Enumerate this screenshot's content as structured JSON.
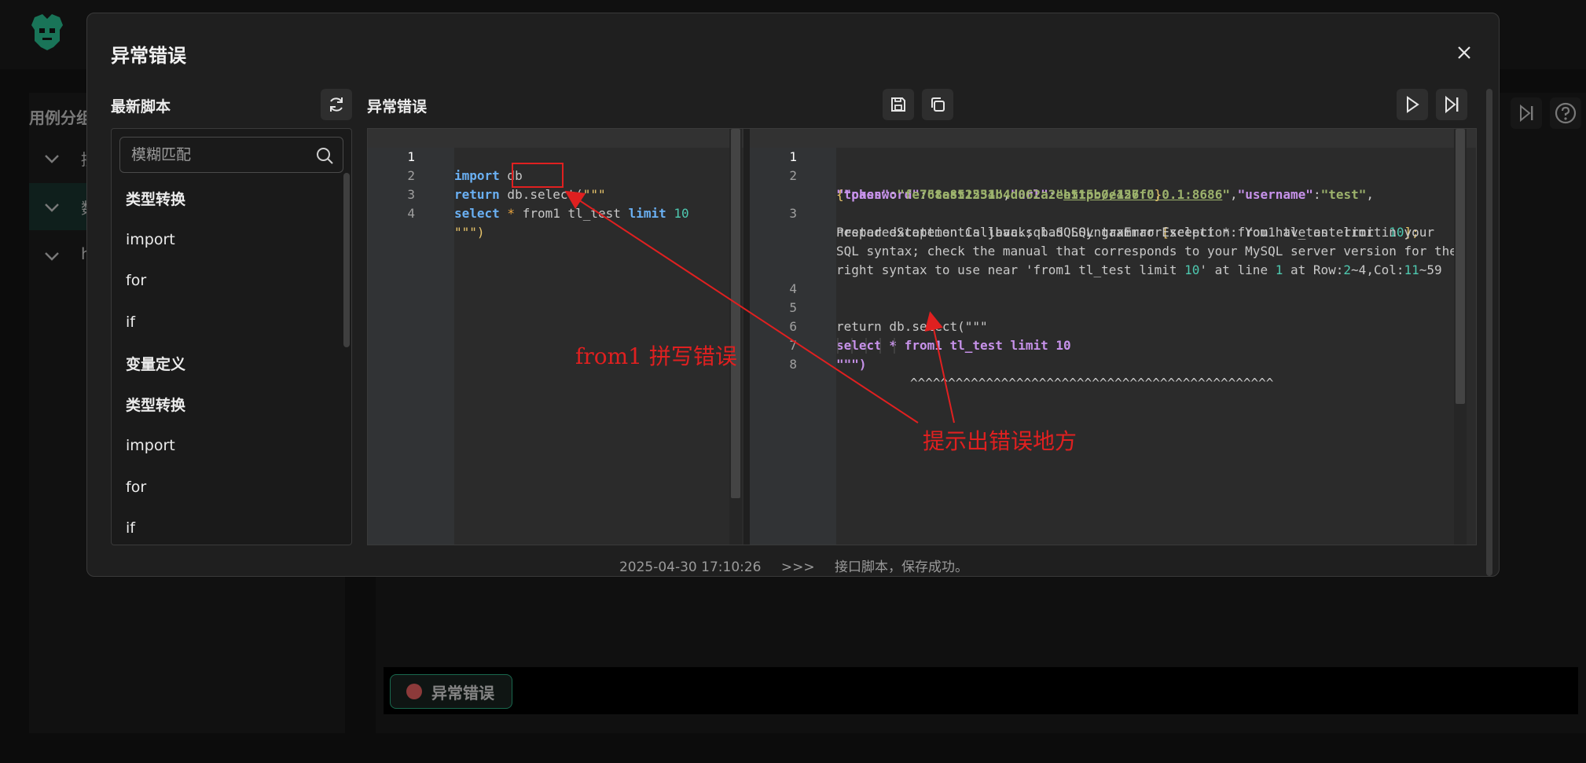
{
  "background": {
    "sidebar_title": "用例分组",
    "tree_items": [
      "接",
      "数",
      "h"
    ],
    "bottom_tag_label": "异常错误"
  },
  "modal": {
    "title": "异常错误",
    "left_panel": {
      "title": "最新脚本",
      "search_placeholder": "模糊匹配",
      "items": [
        {
          "label": "类型转换",
          "bold": true
        },
        {
          "label": "import",
          "bold": false
        },
        {
          "label": "for",
          "bold": false
        },
        {
          "label": "if",
          "bold": false
        },
        {
          "label": "变量定义",
          "bold": true
        },
        {
          "label": "类型转换",
          "bold": true
        },
        {
          "label": "import",
          "bold": false
        },
        {
          "label": "for",
          "bold": false
        },
        {
          "label": "if",
          "bold": false
        }
      ]
    },
    "editor_title": "异常错误",
    "source_code": {
      "line_numbers": [
        "1",
        "2",
        "3",
        "4"
      ],
      "l1_kw": "import",
      "l1_rest": " db",
      "l2_kw": "return",
      "l2_rest": " db.select(",
      "l2_str": "\"\"\"",
      "l3_kw": "select",
      "l3_star": " * ",
      "l3_from": "from1",
      "l3_table": " tl_test ",
      "l3_limit": "limit",
      "l3_num": " 10",
      "l4_str": "\"\"\")"
    },
    "error_output": {
      "line_numbers": [
        "1",
        "2",
        "3",
        "4",
        "5",
        "6",
        "7",
        "8"
      ],
      "json_open": "{",
      "k_password": "\"password\"",
      "v_password": "\"test1234\"",
      "k_url": "\"url\"",
      "v_url_q1": "\"",
      "v_url": "http://127.0.0.1:8686",
      "v_url_q2": "\"",
      "k_username": "\"username\"",
      "v_username": "\"test\"",
      "k_token": "\"token\"",
      "v_token": "\"fe768a852551b4d062a2ee515b0e456f\"",
      "json_close": "}",
      "err_a": "PreparedStatementCallback; bad SQL grammar ",
      "err_b_open": "[",
      "err_c": "select * from1 tl_test limit ",
      "err_c_num": "10",
      "err_d": "];",
      "err_line2": "nested exception is java.sql.SQLSyntaxErrorException: You have an error in your",
      "err_line3": "SQL syntax; check the manual that corresponds to your MySQL server version for the",
      "err_line4a": "right syntax to use near 'from1 tl_test limit ",
      "err_line4b": "10",
      "err_line4c": "' at line ",
      "err_line4d": "1",
      "err_line4e": " at Row:",
      "err_line4f": "2",
      "err_line4g": "~4,Col:",
      "err_line4h": "11",
      "err_line4i": "~59",
      "l5_return": "return db.select(\"\"\"",
      "l6_sql": "select * from1 tl_test limit 10",
      "l7_close": "\"\"\")",
      "l8_caret": "^^^^^^^^^^^^^^^^^^^^^^^^^^^^^^^^^^^^^^^^^^^^^^^^"
    },
    "status": {
      "timestamp": "2025-04-30 17:10:26",
      "separator": ">>>",
      "message": "接口脚本，保存成功。"
    }
  },
  "annotations": {
    "spelling_error": "from1  拼写错误",
    "error_location": "提示出错误地方"
  },
  "colors": {
    "accent": "#2fbf8f",
    "annotation": "#e02020",
    "modal_bg": "#1f1f1f",
    "editor_bg": "#2b2b2b"
  },
  "icons": {
    "logo": "robot-head-logo",
    "close": "close-icon",
    "refresh": "refresh-icon",
    "search": "search-icon",
    "save": "save-icon",
    "copy": "copy-icon",
    "run": "play-icon",
    "step": "step-forward-icon",
    "help": "help-icon"
  }
}
